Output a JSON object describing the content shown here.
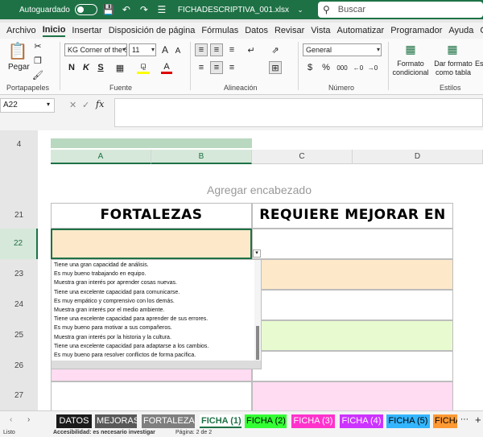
{
  "titlebar": {
    "autosave_label": "Autoguardado",
    "filename": "FICHADESCRIPTIVA_001.xlsx",
    "search_placeholder": "Buscar"
  },
  "ribbon_tabs": [
    "Archivo",
    "Inicio",
    "Insertar",
    "Disposición de página",
    "Fórmulas",
    "Datos",
    "Revisar",
    "Vista",
    "Automatizar",
    "Programador",
    "Ayuda",
    "Canon Free"
  ],
  "ribbon": {
    "paste_label": "Pegar",
    "font_name": "KG Corner of the S",
    "font_size": "11",
    "number_format": "General",
    "conditional_format_label_1": "Formato",
    "conditional_format_label_2": "condicional",
    "format_as_table_label_1": "Dar formato",
    "format_as_table_label_2": "como tabla",
    "cell_styles_label": "Es",
    "groups": {
      "clipboard": "Portapapeles",
      "font": "Fuente",
      "alignment": "Alineación",
      "number": "Número",
      "styles": "Estilos"
    },
    "bold": "N",
    "italic": "K",
    "underline": "S",
    "grow_font": "A",
    "shrink_font": "A",
    "font_color_letter": "A",
    "currency": "$",
    "percent": "%",
    "thousands": "000",
    "inc_decimal": ",00 →,0",
    "dec_decimal": ",0 →,00"
  },
  "formula_bar": {
    "name_box": "A22",
    "fx": "fx",
    "content": ""
  },
  "columns": [
    {
      "id": "A",
      "selected": true
    },
    {
      "id": "B",
      "selected": true
    },
    {
      "id": "C",
      "selected": false
    },
    {
      "id": "D",
      "selected": false
    }
  ],
  "rows": [
    {
      "num": "4",
      "selected": false
    },
    {
      "num": "21",
      "selected": false
    },
    {
      "num": "22",
      "selected": true
    },
    {
      "num": "23",
      "selected": false
    },
    {
      "num": "24",
      "selected": false
    },
    {
      "num": "25",
      "selected": false
    },
    {
      "num": "26",
      "selected": false
    },
    {
      "num": "27",
      "selected": false
    }
  ],
  "header_placeholder": "Agregar encabezado",
  "table": {
    "col1_header": "FORTALEZAS",
    "col2_header": "REQUIERE MEJORAR EN"
  },
  "dropdown_options": [
    "Tiene una gran capacidad de análisis.",
    "Es muy bueno trabajando en equipo.",
    "Muestra gran interés por aprender cosas nuevas.",
    "Tiene una excelente capacidad para comunicarse.",
    "Es muy empático y comprensivo con los demás.",
    "Muestra gran interés por el medio ambiente.",
    "Tiene una excelente capacidad para aprender de sus errores.",
    "Es muy bueno para motivar a sus compañeros.",
    "Muestra gran interés por la historia y la cultura.",
    "Tiene una excelente capacidad para adaptarse a los cambios.",
    "Es muy bueno para resolver conflictos de forma pacífica."
  ],
  "sheet_tabs": [
    {
      "label": "DATOS",
      "bg": "#1a1a1a",
      "fg": "#ffffff"
    },
    {
      "label": "MEJORAS",
      "bg": "#595959",
      "fg": "#ffffff"
    },
    {
      "label": "FORTALEZAS",
      "bg": "#7f7f7f",
      "fg": "#ffffff"
    },
    {
      "label": "FICHA (1)",
      "bg": "#ffffff",
      "fg": "#1e7145"
    },
    {
      "label": "FICHA (2)",
      "bg": "#33ff33",
      "fg": "#000000"
    },
    {
      "label": "FICHA (3)",
      "bg": "#ff33cc",
      "fg": "#ffffff"
    },
    {
      "label": "FICHA (4)",
      "bg": "#cc33ff",
      "fg": "#ffffff"
    },
    {
      "label": "FICHA (5)",
      "bg": "#33b5ff",
      "fg": "#000000"
    },
    {
      "label": "FICHA",
      "bg": "#ff9933",
      "fg": "#000000"
    }
  ],
  "status": {
    "list": "Listo",
    "accessibility": "Accesibilidad: es necesario investigar",
    "page": "Página: 2 de 2"
  },
  "colors": {
    "excel_green": "#1e7145",
    "fortaleza_fill": "#fde9c9",
    "green_fill": "#e8fbd0",
    "pink_fill": "#ffdcf2"
  }
}
